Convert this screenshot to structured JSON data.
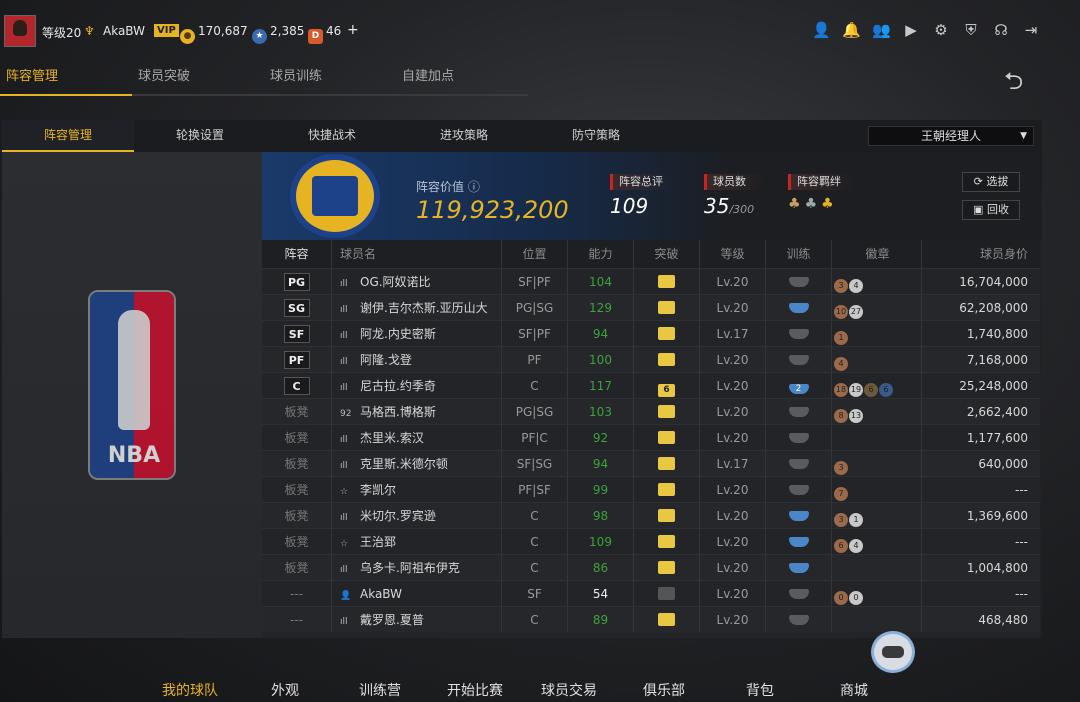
{
  "topbar": {
    "level": "等级20",
    "username": "AkaBW",
    "vip": "VIP",
    "coins": "170,687",
    "stars": "2,385",
    "tickets": "46",
    "plus": "+"
  },
  "main_tabs": [
    "阵容管理",
    "球员突破",
    "球员训练",
    "自建加点"
  ],
  "sub_tabs": [
    "阵容管理",
    "轮换设置",
    "快捷战术",
    "进攻策略",
    "防守策略"
  ],
  "manager_select": "王朝经理人",
  "header": {
    "value_label": "阵容价值",
    "value": "119,923,200",
    "overall_label": "阵容总评",
    "overall": "109",
    "players_label": "球员数",
    "players": "35",
    "players_max": "/300",
    "chem_label": "阵容羁绊",
    "btn_select": "选拔",
    "btn_back": "回收"
  },
  "table": {
    "headers": [
      "阵容",
      "球员名",
      "位置",
      "能力",
      "突破",
      "等级",
      "训练",
      "徽章",
      "球员身价"
    ],
    "rows": [
      {
        "pos": "PG",
        "starter": true,
        "name": "OG.阿奴诺比",
        "slot": "SF|PF",
        "ovr": "104",
        "brk": "",
        "lv": "Lv.20",
        "tr": "",
        "badges": [
          "3",
          "4"
        ],
        "salary": "16,704,000"
      },
      {
        "pos": "SG",
        "starter": true,
        "name": "谢伊.吉尔杰斯.亚历山大",
        "slot": "PG|SG",
        "ovr": "129",
        "brk": "",
        "lv": "Lv.20",
        "tr": "",
        "trblue": true,
        "badges": [
          "10",
          "27"
        ],
        "salary": "62,208,000"
      },
      {
        "pos": "SF",
        "starter": true,
        "name": "阿龙.内史密斯",
        "slot": "SF|PF",
        "ovr": "94",
        "brk": "",
        "lv": "Lv.17",
        "tr": "",
        "badges": [
          "1"
        ],
        "salary": "1,740,800"
      },
      {
        "pos": "PF",
        "starter": true,
        "name": "阿隆.戈登",
        "slot": "PF",
        "ovr": "100",
        "brk": "",
        "lv": "Lv.20",
        "tr": "",
        "badges": [
          "4"
        ],
        "salary": "7,168,000"
      },
      {
        "pos": "C",
        "starter": true,
        "name": "尼古拉.约季奇",
        "slot": "C",
        "ovr": "117",
        "brk": "6",
        "lv": "Lv.20",
        "tr": "2",
        "trblue": true,
        "badges": [
          "18",
          "19",
          "6",
          "6"
        ],
        "salary": "25,248,000"
      },
      {
        "pos": "板凳",
        "starter": false,
        "icon": "92",
        "name": "马格西.博格斯",
        "slot": "PG|SG",
        "ovr": "103",
        "brk": "",
        "lv": "Lv.20",
        "tr": "",
        "badges": [
          "8",
          "13"
        ],
        "salary": "2,662,400"
      },
      {
        "pos": "板凳",
        "starter": false,
        "name": "杰里米.索汉",
        "slot": "PF|C",
        "ovr": "92",
        "brk": "",
        "lv": "Lv.20",
        "tr": "",
        "badges": [],
        "salary": "1,177,600"
      },
      {
        "pos": "板凳",
        "starter": false,
        "name": "克里斯.米德尔顿",
        "slot": "SF|SG",
        "ovr": "94",
        "brk": "",
        "lv": "Lv.17",
        "tr": "",
        "badges": [
          "3"
        ],
        "salary": "640,000"
      },
      {
        "pos": "板凳",
        "starter": false,
        "star": true,
        "name": "李凯尔",
        "slot": "PF|SF",
        "ovr": "99",
        "brk": "",
        "lv": "Lv.20",
        "tr": "",
        "badges": [
          "7"
        ],
        "salary": "---"
      },
      {
        "pos": "板凳",
        "starter": false,
        "name": "米切尔.罗宾逊",
        "slot": "C",
        "ovr": "98",
        "brk": "",
        "lv": "Lv.20",
        "tr": "",
        "trblue": true,
        "badges": [
          "3",
          "1"
        ],
        "salary": "1,369,600"
      },
      {
        "pos": "板凳",
        "starter": false,
        "star": true,
        "name": "王治郅",
        "slot": "C",
        "ovr": "109",
        "brk": "",
        "lv": "Lv.20",
        "tr": "",
        "trblue": true,
        "badges": [
          "6",
          "4"
        ],
        "salary": "---"
      },
      {
        "pos": "板凳",
        "starter": false,
        "name": "乌多卡.阿祖布伊克",
        "slot": "C",
        "ovr": "86",
        "brk": "",
        "lv": "Lv.20",
        "tr": "",
        "trblue": true,
        "badges": [],
        "salary": "1,004,800"
      },
      {
        "pos": "---",
        "starter": false,
        "user": true,
        "name": "AkaBW",
        "slot": "SF",
        "ovr": "54",
        "ovrWhite": true,
        "brk": "",
        "brkGray": true,
        "lv": "Lv.20",
        "tr": "",
        "badges": [
          "0",
          "0"
        ],
        "salary": "---"
      },
      {
        "pos": "---",
        "starter": false,
        "name": "戴罗恩.夏普",
        "slot": "C",
        "ovr": "89",
        "brk": "",
        "lv": "Lv.20",
        "tr": "",
        "badges": [],
        "salary": "468,480"
      }
    ]
  },
  "bottom_nav": [
    "我的球队",
    "外观",
    "训练营",
    "开始比赛",
    "球员交易",
    "俱乐部",
    "背包",
    "商城"
  ]
}
